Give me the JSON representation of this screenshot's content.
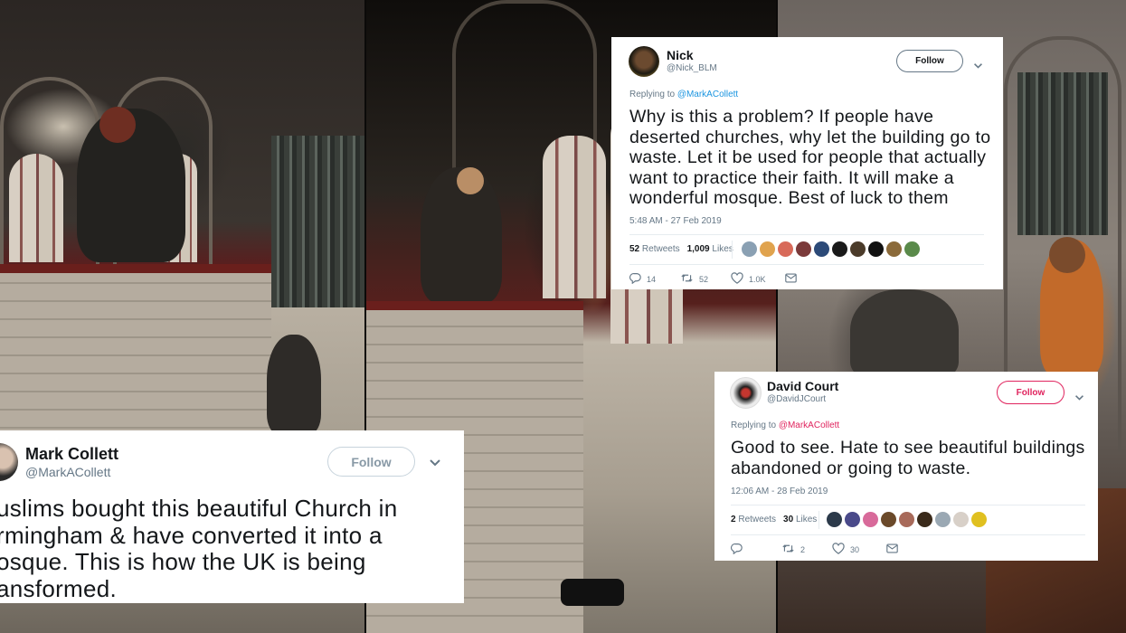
{
  "tweets": [
    {
      "name": "Mark Collett",
      "handle": "@MarkACollett",
      "follow_label": "Follow",
      "text": "uslims bought this beautiful Church in\nrmingham & have converted it into a\nosque. This is how the UK is being\nansformed."
    },
    {
      "name": "Nick",
      "handle": "@Nick_BLM",
      "follow_label": "Follow",
      "replying_prefix": "Replying to",
      "replying_to": "@MarkACollett",
      "text": "Why is this a problem? If people have deserted churches, why let the building go to waste. Let it be used for people that actually want to practice their faith. It will make a wonderful mosque. Best of luck to them",
      "timestamp": "5:48 AM - 27 Feb 2019",
      "retweets": "52",
      "retweets_label": "Retweets",
      "likes": "1,009",
      "likes_label": "Likes",
      "reply_count": "14",
      "retweet_count": "52",
      "like_count": "1.0K"
    },
    {
      "name": "David Court",
      "handle": "@DavidJCourt",
      "follow_label": "Follow",
      "replying_prefix": "Replying to",
      "replying_to": "@MarkACollett",
      "text": "Good to see. Hate to see beautiful buildings abandoned or going to waste.",
      "timestamp": "12:06 AM - 28 Feb 2019",
      "retweets": "2",
      "retweets_label": "Retweets",
      "likes": "30",
      "likes_label": "Likes",
      "reply_count": "",
      "retweet_count": "2",
      "like_count": "30"
    }
  ],
  "colors": {
    "follow_blue": "#1da1f2",
    "follow_red": "#e0245e",
    "text": "#14171a",
    "muted": "#657786",
    "link": "#1b95e0"
  },
  "icons": [
    "chevron-down-icon",
    "reply-icon",
    "retweet-icon",
    "like-icon",
    "dm-icon"
  ]
}
